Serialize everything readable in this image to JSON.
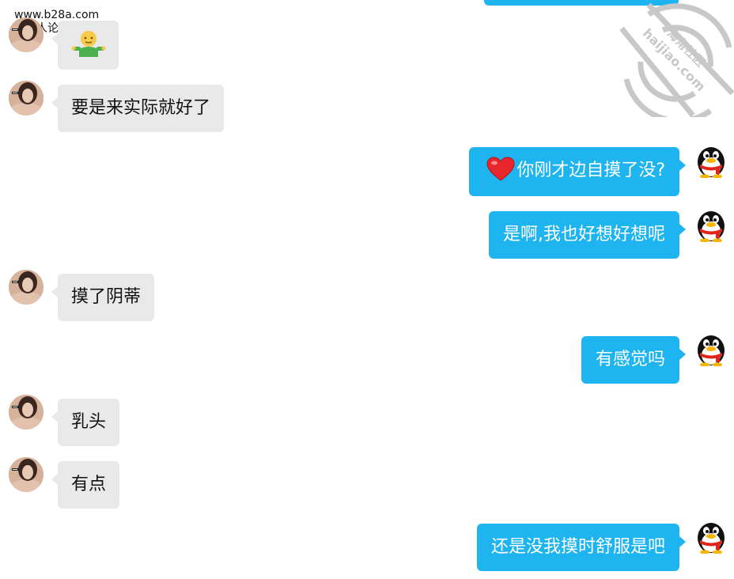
{
  "site": {
    "url": "www.b28a.com",
    "name": "成人论坛"
  },
  "watermark": {
    "name": "海角社区",
    "domain": "haijiao.com"
  },
  "messages": [
    {
      "side": "left",
      "type": "emoji",
      "icon": "shrug-emoji"
    },
    {
      "side": "left",
      "text": "要是来实际就好了"
    },
    {
      "side": "right",
      "text": "你刚才边自摸了没?",
      "icon": "heart-emoji"
    },
    {
      "side": "right",
      "text": "是啊,我也好想好想呢"
    },
    {
      "side": "left",
      "text": "摸了阴蒂"
    },
    {
      "side": "right",
      "text": "有感觉吗"
    },
    {
      "side": "left",
      "text": "乳头"
    },
    {
      "side": "left",
      "text": "有点"
    },
    {
      "side": "right",
      "text": "还是没我摸时舒服是吧"
    }
  ],
  "colors": {
    "right_bubble": "#1eb4f0",
    "left_bubble": "#e9e9e9",
    "background": "#ffffff"
  }
}
